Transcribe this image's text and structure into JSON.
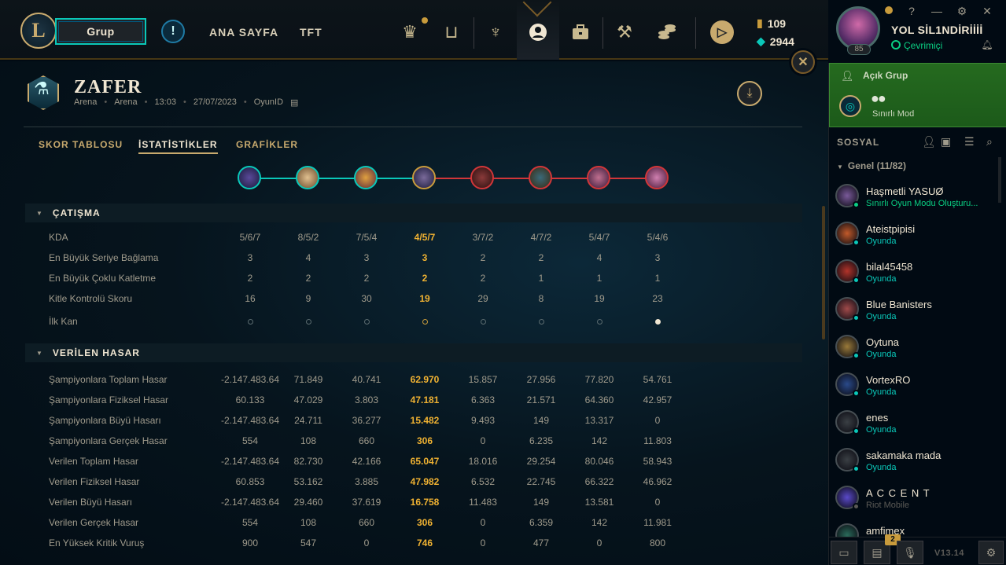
{
  "topbar": {
    "logo_letter": "L",
    "grup_label": "Grup",
    "alert_glyph": "!",
    "nav": [
      "ANA SAYFA",
      "TFT"
    ],
    "currency": {
      "be": "109",
      "rp": "2944"
    }
  },
  "profile": {
    "name": "YOL SİL1NDİRİİİİ",
    "status": "Çevrimiçi",
    "level": "85"
  },
  "match": {
    "result": "ZAFER",
    "meta": [
      "Arena",
      "Arena",
      "13:03",
      "27/07/2023",
      "OyunID"
    ]
  },
  "tabs": [
    "SKOR TABLOSU",
    "İSTATİSTİKLER",
    "GRAFİKLER"
  ],
  "highlight_index": 3,
  "colors": {
    "highlight": "#f0b232",
    "blue_team": "#0ac8b9",
    "red_team": "#d13639",
    "online": "#0acf83",
    "ingame": "#0ac8b9"
  },
  "sections": {
    "combat": {
      "title": "ÇATIŞMA",
      "rows": [
        {
          "label": "KDA",
          "values": [
            "5/6/7",
            "8/5/2",
            "7/5/4",
            "4/5/7",
            "3/7/2",
            "4/7/2",
            "5/4/7",
            "5/4/6"
          ]
        },
        {
          "label": "En Büyük Seriye Bağlama",
          "values": [
            "3",
            "4",
            "3",
            "3",
            "2",
            "2",
            "4",
            "3"
          ]
        },
        {
          "label": "En Büyük Çoklu Katletme",
          "values": [
            "2",
            "2",
            "2",
            "2",
            "2",
            "1",
            "1",
            "1"
          ]
        },
        {
          "label": "Kitle Kontrolü Skoru",
          "values": [
            "16",
            "9",
            "30",
            "19",
            "29",
            "8",
            "19",
            "23"
          ]
        }
      ],
      "first_blood": {
        "label": "İlk Kan",
        "winner_index": 7
      }
    },
    "damage": {
      "title": "VERİLEN HASAR",
      "rows": [
        {
          "label": "Şampiyonlara Toplam Hasar",
          "values": [
            "-2.147.483.64",
            "71.849",
            "40.741",
            "62.970",
            "15.857",
            "27.956",
            "77.820",
            "54.761"
          ]
        },
        {
          "label": "Şampiyonlara Fiziksel Hasar",
          "values": [
            "60.133",
            "47.029",
            "3.803",
            "47.181",
            "6.363",
            "21.571",
            "64.360",
            "42.957"
          ]
        },
        {
          "label": "Şampiyonlara Büyü Hasarı",
          "values": [
            "-2.147.483.64",
            "24.711",
            "36.277",
            "15.482",
            "9.493",
            "149",
            "13.317",
            "0"
          ]
        },
        {
          "label": "Şampiyonlara Gerçek Hasar",
          "values": [
            "554",
            "108",
            "660",
            "306",
            "0",
            "6.235",
            "142",
            "11.803"
          ]
        },
        {
          "label": "Verilen Toplam Hasar",
          "values": [
            "-2.147.483.64",
            "82.730",
            "42.166",
            "65.047",
            "18.016",
            "29.254",
            "80.046",
            "58.943"
          ]
        },
        {
          "label": "Verilen Fiziksel Hasar",
          "values": [
            "60.853",
            "53.162",
            "3.885",
            "47.982",
            "6.532",
            "22.745",
            "66.322",
            "46.962"
          ]
        },
        {
          "label": "Verilen Büyü Hasarı",
          "values": [
            "-2.147.483.64",
            "29.460",
            "37.619",
            "16.758",
            "11.483",
            "149",
            "13.581",
            "0"
          ]
        },
        {
          "label": "Verilen Gerçek Hasar",
          "values": [
            "554",
            "108",
            "660",
            "306",
            "0",
            "6.359",
            "142",
            "11.981"
          ]
        },
        {
          "label": "En Yüksek Kritik Vuruş",
          "values": [
            "900",
            "547",
            "0",
            "746",
            "0",
            "477",
            "0",
            "800"
          ]
        }
      ]
    }
  },
  "social": {
    "lobby_title": "Açık Grup",
    "lobby_mode": "Sınırlı Mod",
    "title": "SOSYAL",
    "group": "Genel (11/82)",
    "friends": [
      {
        "name": "Haşmetli YASUØ",
        "activity": "Sınırlı Oyun Modu Oluşturu...",
        "state": "online",
        "avatar_color": "#7a5a9a"
      },
      {
        "name": "Ateistpipisi",
        "activity": "Oyunda",
        "state": "ingame",
        "avatar_color": "#c25a2a"
      },
      {
        "name": "bilal45458",
        "activity": "Oyunda",
        "state": "ingame",
        "avatar_color": "#b2342a"
      },
      {
        "name": "Blue Banisters",
        "activity": "Oyunda",
        "state": "ingame",
        "avatar_color": "#a04a4a"
      },
      {
        "name": "Oytuna",
        "activity": "Oyunda",
        "state": "ingame",
        "avatar_color": "#9a7a3a"
      },
      {
        "name": "VortexRO",
        "activity": "Oyunda",
        "state": "ingame",
        "avatar_color": "#2a4a8a"
      },
      {
        "name": "enes",
        "activity": "Oyunda",
        "state": "ingame",
        "avatar_color": "#3a3f44"
      },
      {
        "name": "sakamaka mada",
        "activity": "Oyunda",
        "state": "ingame",
        "avatar_color": "#3a3f44"
      },
      {
        "name": "A C C E N T",
        "activity": "Riot Mobile",
        "state": "mobile",
        "avatar_color": "#5a4aca"
      },
      {
        "name": "amfimex",
        "activity": "",
        "state": "ingame",
        "avatar_color": "#2a6a5a"
      }
    ],
    "chat_badge": "2",
    "version": "V13.14"
  }
}
